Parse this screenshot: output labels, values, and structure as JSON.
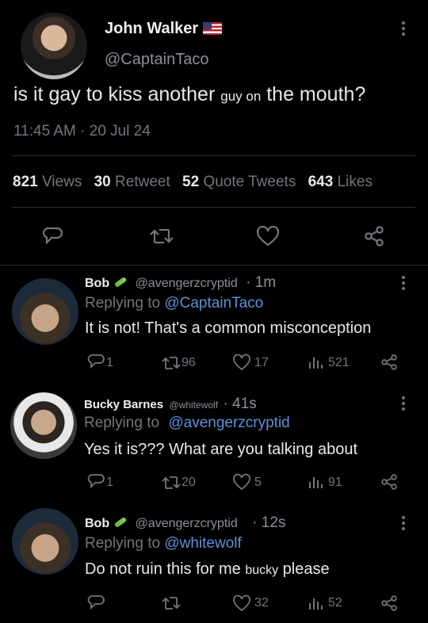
{
  "main_tweet": {
    "display_name": "John Walker",
    "handle": "@CaptainTaco",
    "text_part1": "is it gay to kiss another ",
    "text_small": "guy on",
    "text_part2": " the mouth?",
    "timestamp": "11:45 AM · 20 Jul 24",
    "stats": {
      "views_num": "821",
      "views_label": " Views",
      "retweet_num": "30",
      "retweet_label": " Retweet",
      "quote_num": "52",
      "quote_label": " Quote Tweets",
      "likes_num": "643",
      "likes_label": " Likes"
    }
  },
  "replies": [
    {
      "name": "Bob",
      "handle": "@avengerzcryptid",
      "time": "· 1m",
      "replying_prefix": "Replying to ",
      "replying_to": "@CaptainTaco",
      "text": "It is not! That's a common misconception",
      "replies": "1",
      "retweets": "96",
      "likes": "17",
      "views": "521"
    },
    {
      "name": "Bucky Barnes",
      "handle": "@whitewolf",
      "time": "· 41s",
      "replying_prefix": "Replying to ",
      "replying_to": "@avengerzcryptid",
      "text": "Yes it is??? What are you talking about",
      "replies": "1",
      "retweets": "20",
      "likes": "5",
      "views": "91"
    },
    {
      "name": "Bob",
      "handle": "@avengerzcryptid",
      "time": "· 12s",
      "replying_prefix": "Replying to ",
      "replying_to": "@whitewolf",
      "text_part1": "Do not ruin this for me ",
      "text_small": "bucky",
      "text_part2": " please",
      "replies": "",
      "retweets": "",
      "likes": "32",
      "views": "52"
    }
  ],
  "icons": {
    "reply": "speech-bubble-icon",
    "retweet": "retweet-icon",
    "like": "heart-icon",
    "views": "bar-chart-icon",
    "share": "share-icon",
    "more": "more-vertical-icon"
  }
}
